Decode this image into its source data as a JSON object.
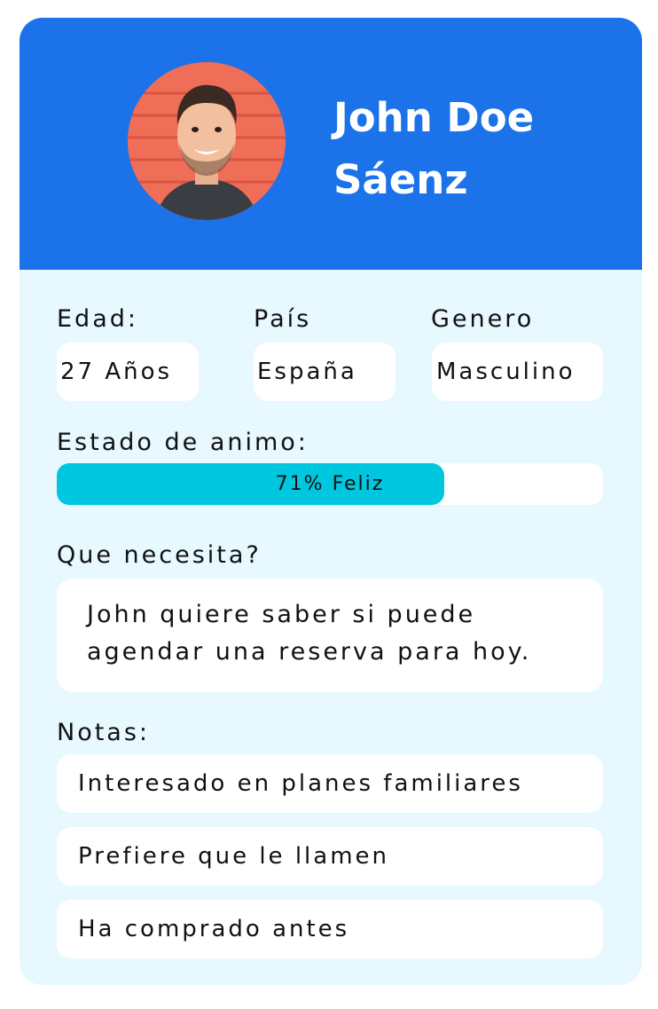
{
  "profile": {
    "first_line": "John Doe",
    "second_line": "Sáenz",
    "avatar_icon": "person-photo-icon"
  },
  "fields": {
    "age_label": "Edad:",
    "age_value": "27 Años",
    "country_label": "País",
    "country_value": "España",
    "gender_label": "Genero",
    "gender_value": "Masculino"
  },
  "mood": {
    "label": "Estado de animo:",
    "percent": 71,
    "text": "71% Feliz"
  },
  "needs": {
    "label": "Que necesita?",
    "line1": "John quiere saber si puede",
    "line2": "agendar una reserva para hoy."
  },
  "notes": {
    "label": "Notas:",
    "items": [
      "Interesado en planes familiares",
      "Prefiere que le llamen",
      "Ha comprado antes"
    ]
  },
  "colors": {
    "header": "#1c72e8",
    "card_bg": "#e7f8fe",
    "mood_fill": "#00c7e0",
    "avatar_bg": "#ef6e57"
  }
}
